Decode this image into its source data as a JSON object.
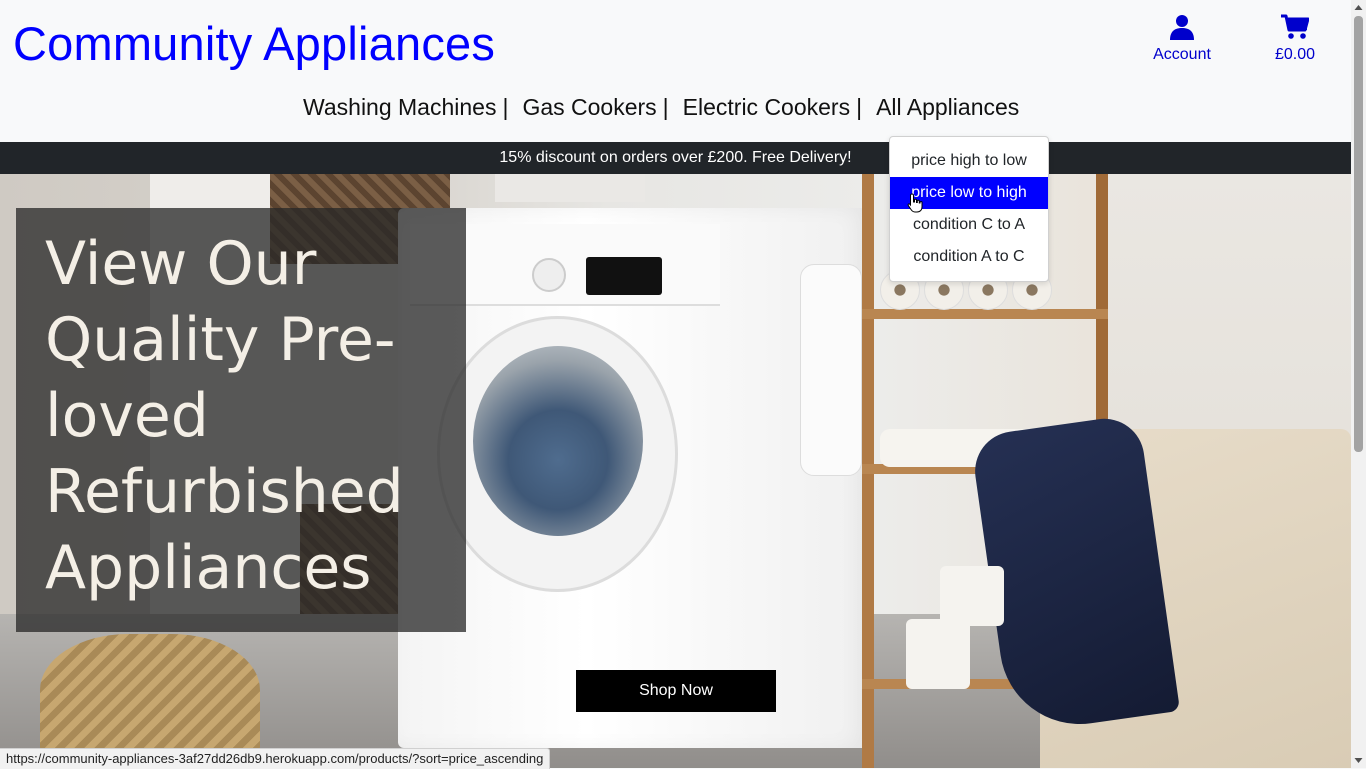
{
  "header": {
    "brand": "Community Appliances",
    "account_label": "Account",
    "cart_total": "£0.00",
    "icons": {
      "account": "user-icon",
      "cart": "shopping-cart-icon"
    }
  },
  "nav": {
    "items": [
      {
        "label": "Washing Machines",
        "sep": "|"
      },
      {
        "label": "Gas Cookers",
        "sep": "|"
      },
      {
        "label": "Electric Cookers",
        "sep": "|"
      },
      {
        "label": "All Appliances",
        "sep": ""
      }
    ]
  },
  "banner": {
    "text": "15% discount on orders over £200. Free Delivery!"
  },
  "hero": {
    "line1": "View Our",
    "line2": "Quality Pre-",
    "line3": "loved",
    "line4": "Refurbished",
    "line5": "Appliances",
    "cta": "Shop Now"
  },
  "sort_menu": {
    "options": [
      {
        "label": "price high to low",
        "active": false
      },
      {
        "label": "price low to high",
        "active": true
      },
      {
        "label": "condition C to A",
        "active": false
      },
      {
        "label": "condition A to C",
        "active": false
      }
    ]
  },
  "status_url": "https://community-appliances-3af27dd26db9.herokuapp.com/products/?sort=price_ascending",
  "colors": {
    "brand": "#0000ff",
    "banner_bg": "#212529",
    "active_option": "#0000ff"
  }
}
